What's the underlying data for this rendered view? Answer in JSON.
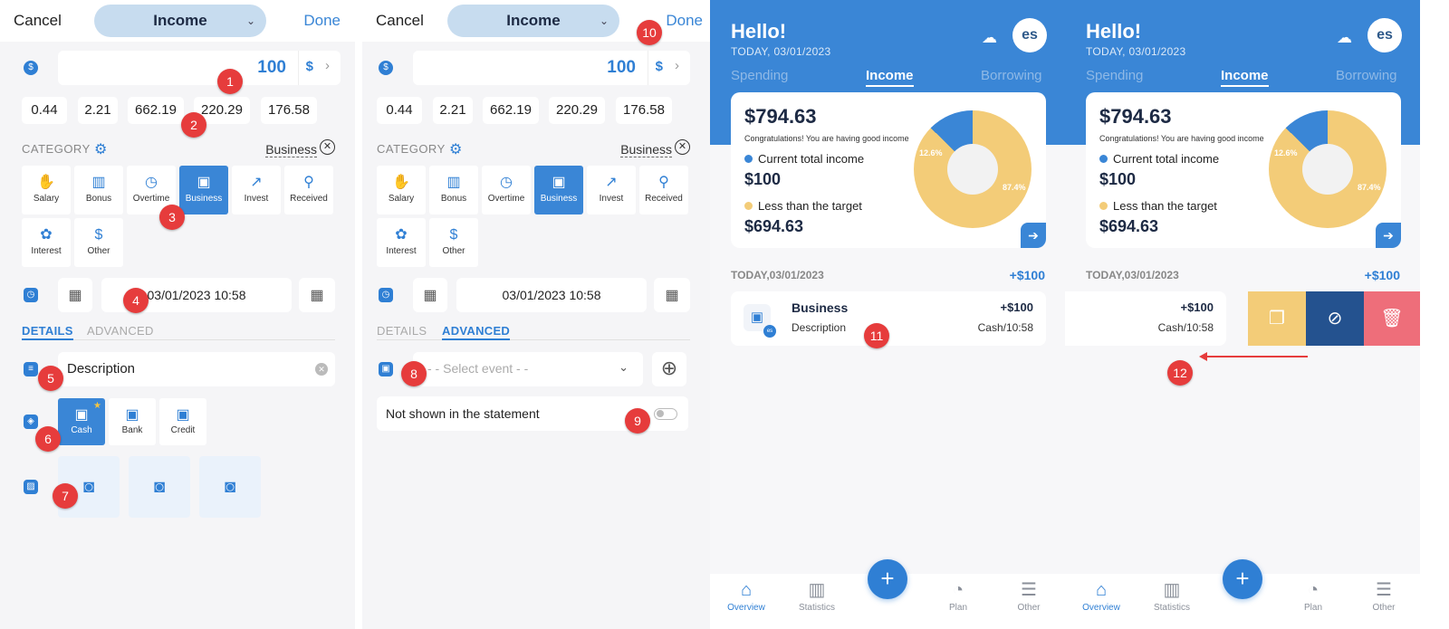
{
  "left_screen": {
    "cancel": "Cancel",
    "type_selected": "Income",
    "done": "Done",
    "amount": "100",
    "currency": "$",
    "quick_amounts": [
      "0.44",
      "2.21",
      "662.19",
      "220.29",
      "176.58"
    ],
    "category_label": "CATEGORY",
    "category_selected": "Business",
    "categories": [
      "Salary",
      "Bonus",
      "Overtime",
      "Business",
      "Invest",
      "Received",
      "Interest",
      "Other"
    ],
    "datetime": "03/01/2023 10:58",
    "tab_details": "DETAILS",
    "tab_advanced": "ADVANCED",
    "description": "Description",
    "accounts": [
      "Cash",
      "Bank",
      "Credit"
    ]
  },
  "middle_screen": {
    "cancel": "Cancel",
    "type_selected": "Income",
    "done": "Done",
    "amount": "100",
    "currency": "$",
    "quick_amounts": [
      "0.44",
      "2.21",
      "662.19",
      "220.29",
      "176.58"
    ],
    "category_label": "CATEGORY",
    "category_selected": "Business",
    "categories": [
      "Salary",
      "Bonus",
      "Overtime",
      "Business",
      "Invest",
      "Received",
      "Interest",
      "Other"
    ],
    "datetime": "03/01/2023 10:58",
    "tab_details": "DETAILS",
    "tab_advanced": "ADVANCED",
    "select_event_placeholder": "- - Select event - -",
    "not_shown_label": "Not shown in the statement"
  },
  "overview": {
    "greeting": "Hello!",
    "date": "TODAY, 03/01/2023",
    "avatar": "es",
    "tabs": [
      "Spending",
      "Income",
      "Borrowing"
    ],
    "total": "$794.63",
    "congrats": "Congratulations! You are having good income",
    "current_label": "Current total income",
    "current_value": "$100",
    "target_label": "Less than the target",
    "target_value": "$694.63",
    "pie_blue_pct": "12.6%",
    "pie_yellow_pct": "87.4%",
    "pie_values": [
      12.6,
      87.4
    ],
    "day_label": "TODAY,03/01/2023",
    "day_total": "+$100",
    "txn_title": "Business",
    "txn_desc": "Description",
    "txn_amount": "+$100",
    "txn_meta": "Cash/10:58",
    "nav": [
      "Overview",
      "Statistics",
      "Plan",
      "Other"
    ],
    "fab": "+"
  },
  "markers": [
    "1",
    "2",
    "3",
    "4",
    "5",
    "6",
    "7",
    "8",
    "9",
    "10",
    "11",
    "12"
  ],
  "colors": {
    "accent": "#3a86d6",
    "pill": "#c7dcef",
    "pie_yellow": "#f3cc78",
    "swipe_yellow": "#f3cc78",
    "swipe_navy": "#24528f",
    "swipe_red": "#ee6e7a",
    "marker_red": "#e63c3c"
  }
}
